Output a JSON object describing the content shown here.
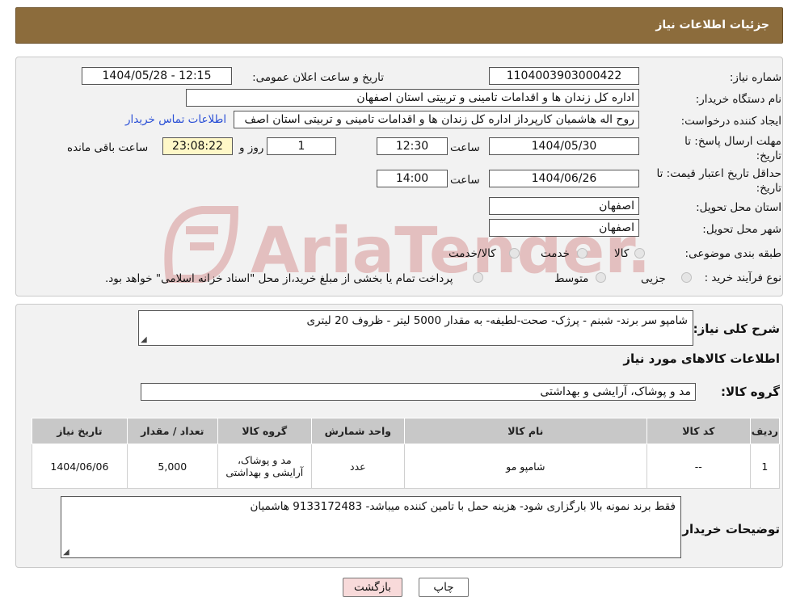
{
  "header": {
    "title": "جزئیات اطلاعات نیاز"
  },
  "form": {
    "need_number_label": "شماره نیاز:",
    "need_number": "1104003903000422",
    "announce_label": "تاریخ و ساعت اعلان عمومی:",
    "announce_value": "1404/05/28 - 12:15",
    "buyer_org_label": "نام دستگاه خریدار:",
    "buyer_org": "اداره کل زندان ها و اقدامات تامینی و تربیتی استان اصفهان",
    "creator_label": "ایجاد کننده درخواست:",
    "creator": "روح اله هاشمیان کارپرداز اداره کل زندان ها و اقدامات تامینی و تربیتی استان اصف",
    "contact_link": "اطلاعات تماس خریدار",
    "deadline_label": "مهلت ارسال پاسخ: تا تاریخ:",
    "deadline_date": "1404/05/30",
    "time_label": "ساعت",
    "deadline_time": "12:30",
    "days_value": "1",
    "days_label": "روز و",
    "remaining_time": "23:08:22",
    "remaining_label": "ساعت باقی مانده",
    "validity_label": "حداقل تاریخ اعتبار قیمت: تا تاریخ:",
    "validity_date": "1404/06/26",
    "validity_time": "14:00",
    "province_label": "استان محل تحویل:",
    "province": "اصفهان",
    "city_label": "شهر محل تحویل:",
    "city": "اصفهان",
    "category_label": "طبقه بندی موضوعی:",
    "category_options": [
      "کالا",
      "خدمت",
      "کالا/خدمت"
    ],
    "process_label": "نوع فرآیند خرید :",
    "process_options": [
      "جزیی",
      "متوسط"
    ],
    "process_note": "پرداخت تمام یا بخشی از مبلغ خرید،از محل \"اسناد خزانه اسلامی\" خواهد بود."
  },
  "details": {
    "desc_label": "شرح کلی نیاز:",
    "desc": "شامپو سر برند- شبنم - پرژک- صحت-لطیفه- به مقدار 5000 لیتر - ظروف 20 لیتری",
    "goods_info_title": "اطلاعات کالاهای مورد نیاز",
    "group_label": "گروه کالا:",
    "group_value": "مد و پوشاک، آرایشی و بهداشتی",
    "table": {
      "headers": [
        "ردیف",
        "کد کالا",
        "نام کالا",
        "واحد شمارش",
        "گروه کالا",
        "تعداد / مقدار",
        "تاریخ نیاز"
      ],
      "rows": [
        [
          "1",
          "--",
          "شامپو مو",
          "عدد",
          "مد و پوشاک، آرایشی و بهداشتی",
          "5,000",
          "1404/06/06"
        ]
      ]
    },
    "buyer_notes_label": "توضیحات خریدار:",
    "buyer_notes": "فقط برند نمونه بالا بارگزاری شود- هزینه حمل با تامین کننده میباشد- 9133172483 هاشمیان"
  },
  "buttons": {
    "print": "چاپ",
    "back": "بازگشت"
  },
  "watermark_text": "AriaTender.neT",
  "colors": {
    "header_bg": "#8c6c3c",
    "link": "#2a4fd6",
    "back_btn_bg": "#f8dada",
    "timer_bg": "#fff8c8"
  }
}
